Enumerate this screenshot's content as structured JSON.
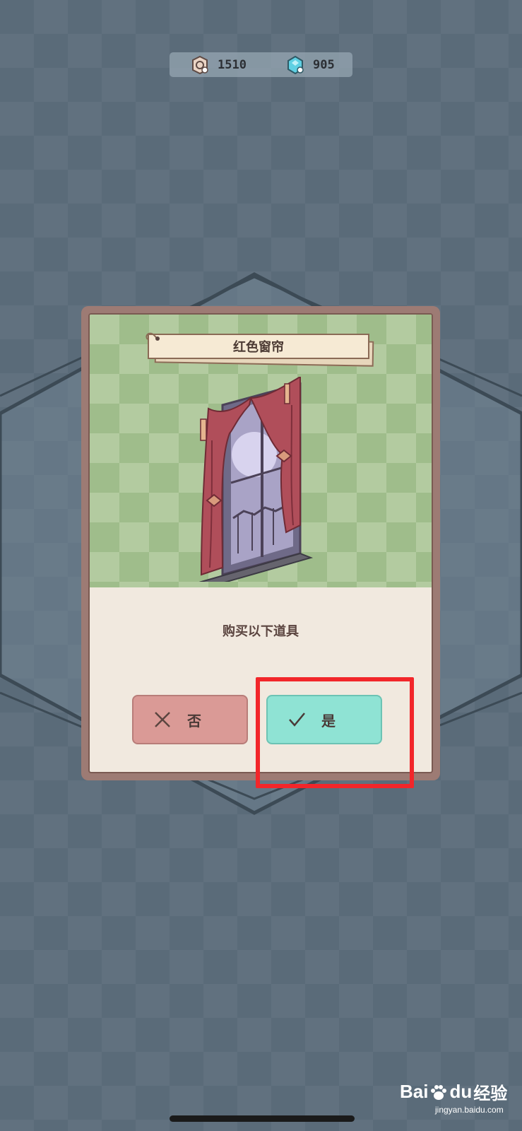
{
  "currency": {
    "coins": "1510",
    "coin_icon": "coin-icon",
    "gems": "905",
    "gem_icon": "gem-icon"
  },
  "dialog": {
    "item_name": "红色窗帘",
    "item_image": "red-curtain-window",
    "prompt": "购买以下道具",
    "no_label": "否",
    "yes_label": "是"
  },
  "watermark": {
    "logo_bai": "Bai",
    "logo_du": "du",
    "logo_jy": "经验",
    "subtitle": "jingyan.baidu.com"
  },
  "colors": {
    "highlight": "#f2262a",
    "yes_button": "#8fe3d4",
    "no_button": "#da9a96"
  }
}
